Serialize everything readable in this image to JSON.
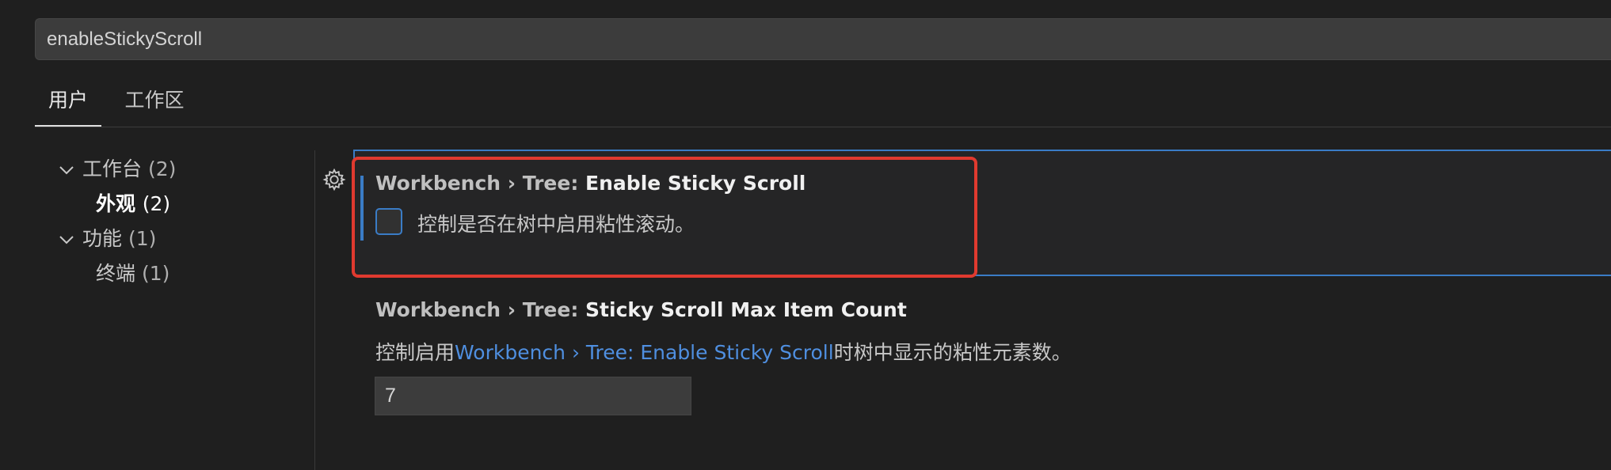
{
  "search": {
    "value": "enableStickyScroll"
  },
  "tabs": [
    {
      "label": "用户"
    },
    {
      "label": "工作区"
    }
  ],
  "toc": {
    "workbench": {
      "label": "工作台",
      "count": "(2)"
    },
    "appearance": {
      "label": "外观",
      "count": "(2)"
    },
    "features": {
      "label": "功能",
      "count": "(1)"
    },
    "terminal": {
      "label": "终端",
      "count": "(1)"
    }
  },
  "setting1": {
    "category": "Workbench › Tree: ",
    "name": "Enable Sticky Scroll",
    "description": "控制是否在树中启用粘性滚动。",
    "checked": false
  },
  "setting2": {
    "category": "Workbench › Tree: ",
    "name": "Sticky Scroll Max Item Count",
    "desc_prefix": "控制启用",
    "desc_link": "Workbench › Tree: Enable Sticky Scroll",
    "desc_suffix": "时树中显示的粘性元素数。",
    "value": "7"
  },
  "colors": {
    "accent": "#3a7cc6",
    "highlight": "#e03a2f",
    "link": "#4f8fe0"
  }
}
